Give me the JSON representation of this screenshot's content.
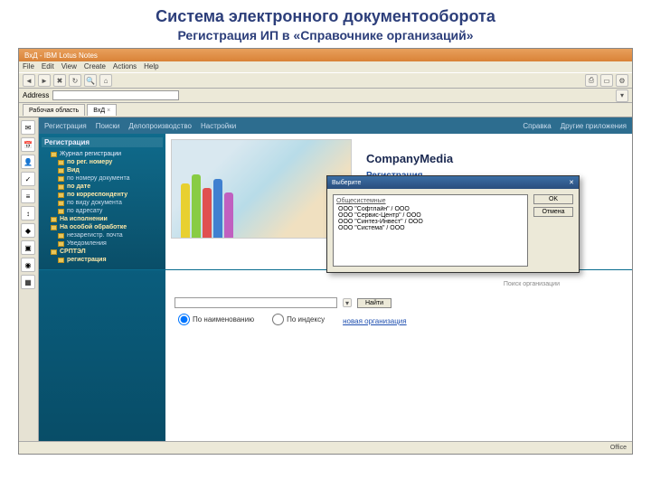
{
  "slide": {
    "title": "Система электронного документооборота",
    "subtitle": "Регистрация ИП в «Справочнике организаций»"
  },
  "window": {
    "title": "ВхД - IBM Lotus Notes",
    "menu": [
      "File",
      "Edit",
      "View",
      "Create",
      "Actions",
      "Help"
    ],
    "address_label": "Address",
    "address_value": "",
    "tabs": [
      {
        "label": "Рабочая область",
        "active": false
      },
      {
        "label": "ВхД",
        "active": true
      }
    ]
  },
  "subnav": {
    "left": [
      "Регистрация",
      "Поиски",
      "Делопроизводство",
      "Настройки"
    ],
    "right": [
      "Справка",
      "Другие приложения"
    ]
  },
  "sidebar": {
    "title": "Регистрация",
    "items": [
      {
        "label": "Журнал регистрации",
        "hl": false,
        "sub": false
      },
      {
        "label": "по рег. номеру",
        "hl": true,
        "sub": true
      },
      {
        "label": "Вид",
        "hl": true,
        "sub": true
      },
      {
        "label": "по номеру документа",
        "hl": false,
        "sub": true
      },
      {
        "label": "по дате",
        "hl": true,
        "sub": true
      },
      {
        "label": "по корреспонденту",
        "hl": true,
        "sub": true
      },
      {
        "label": "по виду документа",
        "hl": false,
        "sub": true
      },
      {
        "label": "по адресату",
        "hl": false,
        "sub": true
      },
      {
        "label": "На исполнении",
        "hl": true,
        "sub": false
      },
      {
        "label": "На особой обработке",
        "hl": true,
        "sub": false
      },
      {
        "label": "незарегистр. почта",
        "hl": false,
        "sub": true
      },
      {
        "label": "Уведомления",
        "hl": false,
        "sub": true
      },
      {
        "label": "СРПТЭЛ",
        "hl": true,
        "sub": false
      },
      {
        "label": "регистрация",
        "hl": true,
        "sub": true
      }
    ]
  },
  "banner": {
    "brand": "CompanyMedia",
    "product": "Регистрация"
  },
  "dialog": {
    "title": "Выберите",
    "close": "✕",
    "list_label": "Общесистемные",
    "options": [
      "ООО \"Софтлайн\" / ООО",
      "ООО \"Сервис-Центр\" / ООО",
      "ООО \"Синтез-Инвест\" / ООО",
      "ООО \"Система\" / ООО"
    ],
    "ok": "OK",
    "cancel": "Отмена"
  },
  "lower": {
    "hint": "Поиск организации",
    "search_btn": "Найти",
    "radios": [
      "По наименованию",
      "По индексу"
    ],
    "link": "новая организация"
  },
  "status": {
    "left": "",
    "right": "Office"
  }
}
